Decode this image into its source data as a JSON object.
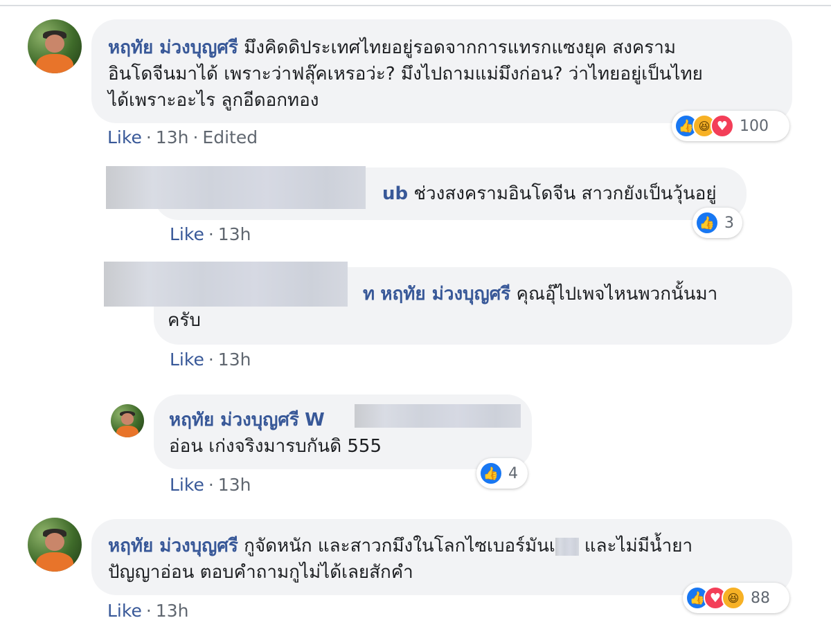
{
  "comments": [
    {
      "author": "หฤทัย ม่วงบุญศรี",
      "lines": [
        "มึงคิดดิประเทศไทยอยู่รอดจากการแทรกแซงยุค สงคราม",
        "อินโดจีนมาได้ เพราะว่าฟลุ๊คเหรอว่ะ? มึงไปถามแม่มึงก่อน? ว่าไทยอยู่เป็นไทย",
        "ได้เพราะอะไร ลูกอีดอกทอง"
      ],
      "like": "Like",
      "time": "13h",
      "edited": "Edited",
      "reaction_count": "100",
      "reactions": [
        "like",
        "haha",
        "love"
      ]
    },
    {
      "author_tail": "ub",
      "lines": [
        "ช่วงสงครามอินโดจีน สาวกยังเป็นวุ้นอยู่"
      ],
      "like": "Like",
      "time": "13h",
      "reaction_count": "3",
      "reactions": [
        "like"
      ]
    },
    {
      "author_tail": "ท",
      "mention": "หฤทัย ม่วงบุญศรี",
      "lines": [
        "คุณอุ๊ไปเพจไหนพวกนั้นมา",
        "ครับ"
      ],
      "like": "Like",
      "time": "13h"
    },
    {
      "author": "หฤทัย ม่วงบุญศรี",
      "mention_head": "W",
      "lines": [
        "อ่อน เก่งจริงมารบกันดิ 555"
      ],
      "like": "Like",
      "time": "13h",
      "reaction_count": "4",
      "reactions": [
        "like"
      ]
    },
    {
      "author": "หฤทัย ม่วงบุญศรี",
      "lines": [
        "กูจัดหนัก และสาวกมึงในโลกไซเบอร์มันเ",
        "ปัญญาอ่อน ตอบคำถามกูไม่ได้เลยสักคำ"
      ],
      "line1_tail": "และไม่มีน้ำยา",
      "like": "Like",
      "time": "13h",
      "reaction_count": "88",
      "reactions": [
        "like",
        "love",
        "haha"
      ]
    }
  ],
  "icons": {
    "like": "👍",
    "haha": "😆",
    "love": "♥"
  },
  "colors": {
    "author": "#385898",
    "bubble": "#f2f3f5",
    "like_reaction": "#1877f2",
    "love_reaction": "#f33e58",
    "haha_reaction": "#f7b125"
  }
}
